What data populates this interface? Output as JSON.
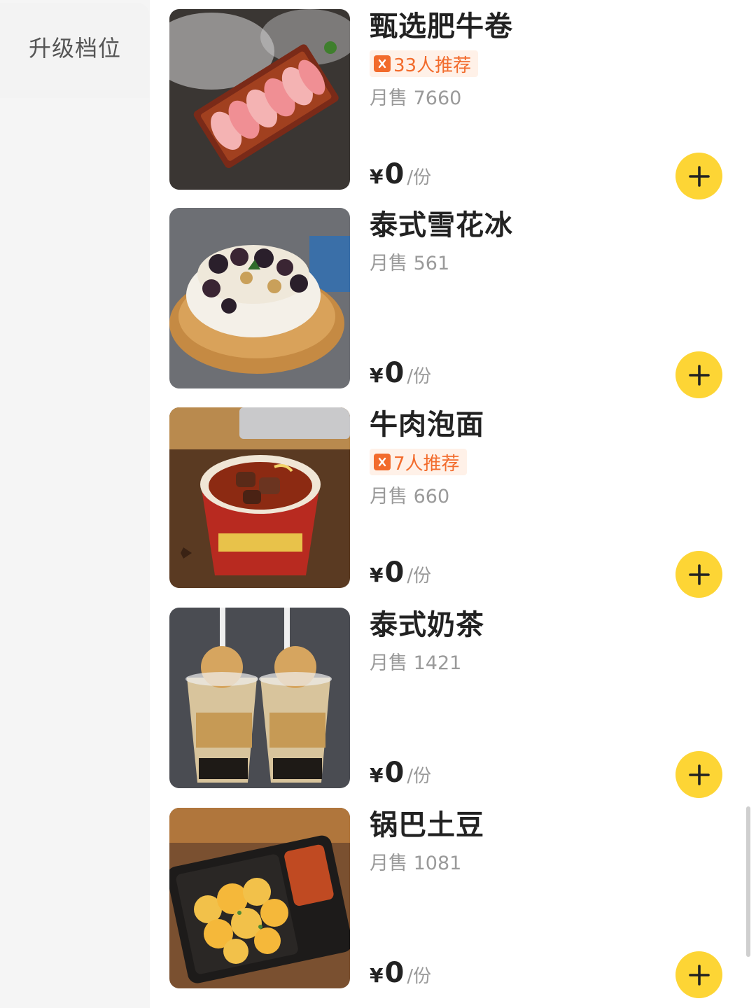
{
  "sidebar": {
    "items": [
      {
        "label": "升级档位"
      }
    ]
  },
  "colors": {
    "accent": "#fdd535",
    "badge_text": "#f26b2c",
    "badge_bg": "#fff1e8",
    "sidebar_bg": "#f5f5f5"
  },
  "icons": {
    "add": "plus-icon",
    "recommend": "recommend-icon"
  },
  "items": [
    {
      "name": "甄选肥牛卷",
      "recommend": "33人推荐",
      "sales": "月售 7660",
      "price_symbol": "¥",
      "price": "0",
      "unit": "/份",
      "image": "sliced beef rolls on wooden plate"
    },
    {
      "name": "泰式雪花冰",
      "sales": "月售 561",
      "price_symbol": "¥",
      "price": "0",
      "unit": "/份",
      "image": "snow ice dessert with toppings"
    },
    {
      "name": "牛肉泡面",
      "recommend": "7人推荐",
      "sales": "月售 660",
      "price_symbol": "¥",
      "price": "0",
      "unit": "/份",
      "image": "beef instant noodle cup"
    },
    {
      "name": "泰式奶茶",
      "sales": "月售 1421",
      "price_symbol": "¥",
      "price": "0",
      "unit": "/份",
      "image": "thai milk tea with ice cream"
    },
    {
      "name": "锅巴土豆",
      "sales": "月售 1081",
      "price_symbol": "¥",
      "price": "0",
      "unit": "/份",
      "image": "fried potato pieces in tray"
    }
  ]
}
